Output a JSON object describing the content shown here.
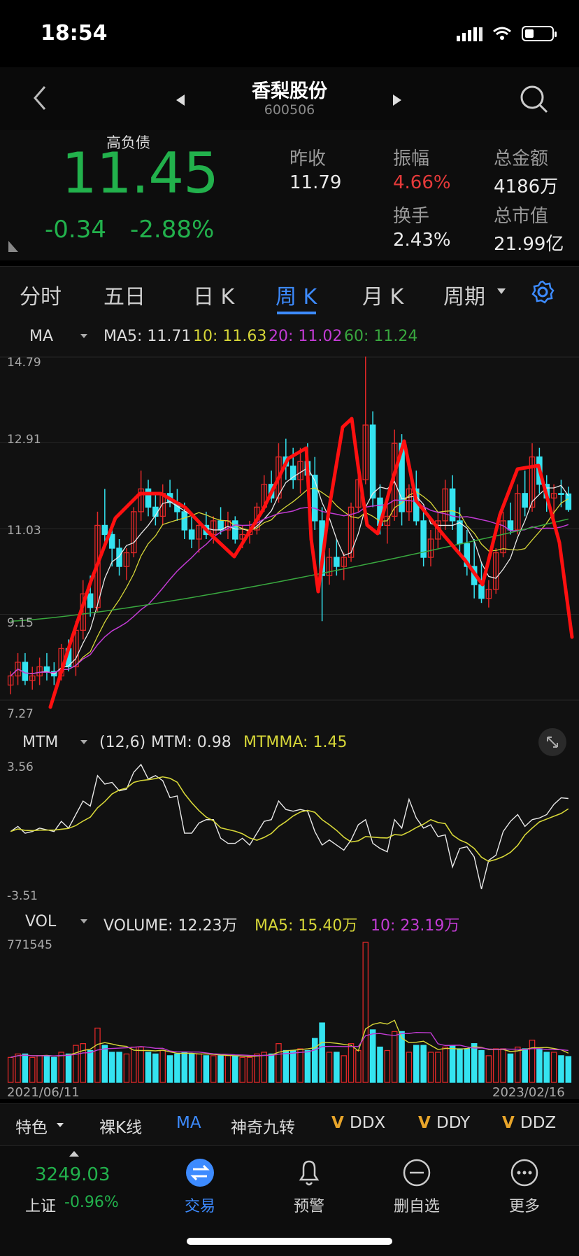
{
  "status": {
    "time": "18:54"
  },
  "header": {
    "title": "香梨股份",
    "code": "600506"
  },
  "quote": {
    "tag": "高负债",
    "price": "11.45",
    "change": "-0.34",
    "change_pct": "-2.88%",
    "stats": [
      {
        "label": "昨收",
        "value": "11.79",
        "color": "#eaeaea"
      },
      {
        "label": "振幅",
        "value": "4.66%",
        "color": "#e63a3a"
      },
      {
        "label": "总金额",
        "value": "4186万",
        "color": "#eaeaea"
      },
      {
        "label": "换手",
        "value": "2.43%",
        "color": "#eaeaea"
      },
      {
        "label": "总市值",
        "value": "21.99亿",
        "color": "#eaeaea"
      }
    ]
  },
  "tabs": [
    "分时",
    "五日",
    "日 K",
    "周 K",
    "月 K",
    "周期"
  ],
  "active_tab": "周 K",
  "ma_legend": {
    "name": "MA",
    "ma5": "MA5: 11.71",
    "ma10": "10: 11.63",
    "ma20": "20: 11.02",
    "ma60": "60: 11.24"
  },
  "mtm_legend": {
    "name": "MTM",
    "params": "(12,6)",
    "mtm": "MTM: 0.98",
    "mtmma": "MTMMA: 1.45"
  },
  "vol_legend": {
    "name": "VOL",
    "volume": "VOLUME: 12.23万",
    "ma5": "MA5: 15.40万",
    "ma10": "10: 23.19万"
  },
  "chart_data": {
    "type": "candlestick",
    "price_axis_labels": [
      "14.79",
      "12.91",
      "11.03",
      "9.15",
      "7.27"
    ],
    "mtm_axis_labels": [
      "3.56",
      "-3.51"
    ],
    "vol_axis_label": "771545",
    "date_start": "2021/06/11",
    "date_end": "2023/02/16",
    "colors": {
      "up": "#e02828",
      "down": "#34e3f0",
      "ma5": "#e8e8e8",
      "ma10": "#d6d638",
      "ma20": "#c23bd4",
      "ma60": "#39a83f",
      "annotation": "#ff1010"
    },
    "ohlc": [
      [
        7.6,
        7.9,
        7.4,
        7.8
      ],
      [
        7.8,
        8.3,
        7.6,
        8.1
      ],
      [
        8.1,
        8.3,
        7.6,
        7.7
      ],
      [
        7.7,
        8.0,
        7.5,
        7.8
      ],
      [
        7.8,
        8.2,
        7.6,
        8.0
      ],
      [
        8.0,
        8.3,
        7.7,
        7.9
      ],
      [
        7.9,
        8.1,
        7.6,
        7.8
      ],
      [
        7.8,
        8.5,
        7.7,
        8.4
      ],
      [
        8.4,
        8.6,
        7.9,
        8.0
      ],
      [
        8.0,
        9.0,
        7.8,
        8.8
      ],
      [
        8.8,
        9.9,
        8.6,
        9.6
      ],
      [
        9.6,
        10.0,
        9.1,
        9.3
      ],
      [
        9.3,
        11.4,
        9.2,
        11.1
      ],
      [
        11.1,
        11.9,
        10.7,
        10.9
      ],
      [
        10.9,
        11.0,
        10.2,
        10.6
      ],
      [
        10.6,
        10.8,
        10.0,
        10.2
      ],
      [
        10.2,
        10.6,
        9.9,
        10.5
      ],
      [
        10.5,
        11.5,
        10.4,
        11.4
      ],
      [
        11.4,
        12.3,
        11.2,
        11.9
      ],
      [
        11.9,
        12.1,
        11.3,
        11.5
      ],
      [
        11.5,
        11.8,
        11.1,
        11.3
      ],
      [
        11.3,
        12.0,
        11.1,
        11.8
      ],
      [
        11.8,
        12.1,
        11.5,
        11.6
      ],
      [
        11.6,
        11.9,
        11.2,
        11.4
      ],
      [
        11.4,
        11.6,
        10.8,
        11.0
      ],
      [
        11.0,
        11.3,
        10.6,
        10.8
      ],
      [
        10.8,
        11.2,
        10.5,
        11.1
      ],
      [
        11.1,
        11.4,
        10.8,
        10.9
      ],
      [
        10.9,
        11.3,
        10.7,
        11.2
      ],
      [
        11.2,
        11.5,
        10.9,
        11.0
      ],
      [
        11.0,
        11.4,
        10.8,
        11.2
      ],
      [
        11.2,
        11.3,
        10.7,
        10.8
      ],
      [
        10.8,
        11.1,
        10.6,
        10.9
      ],
      [
        10.9,
        11.2,
        10.7,
        11.0
      ],
      [
        11.0,
        11.6,
        10.9,
        11.5
      ],
      [
        11.5,
        12.2,
        11.4,
        12.0
      ],
      [
        12.0,
        12.3,
        11.6,
        11.7
      ],
      [
        11.7,
        12.9,
        11.6,
        12.6
      ],
      [
        12.6,
        13.0,
        12.1,
        12.4
      ],
      [
        12.4,
        12.8,
        11.9,
        12.1
      ],
      [
        12.1,
        12.8,
        11.8,
        12.5
      ],
      [
        12.5,
        12.9,
        12.0,
        12.2
      ],
      [
        12.2,
        12.6,
        11.0,
        11.2
      ],
      [
        11.2,
        11.5,
        9.0,
        10.0
      ],
      [
        10.0,
        10.6,
        9.8,
        10.4
      ],
      [
        10.4,
        10.8,
        10.0,
        10.2
      ],
      [
        10.2,
        10.5,
        9.9,
        10.4
      ],
      [
        10.4,
        11.6,
        10.3,
        11.5
      ],
      [
        11.5,
        12.3,
        11.4,
        12.1
      ],
      [
        12.1,
        14.8,
        12.0,
        13.3
      ],
      [
        13.3,
        13.6,
        11.5,
        11.7
      ],
      [
        11.7,
        12.0,
        10.9,
        11.1
      ],
      [
        11.1,
        11.6,
        10.7,
        11.3
      ],
      [
        11.3,
        13.2,
        11.2,
        12.9
      ],
      [
        12.9,
        13.1,
        11.1,
        11.4
      ],
      [
        11.4,
        12.0,
        11.2,
        11.9
      ],
      [
        11.9,
        12.3,
        11.1,
        11.2
      ],
      [
        11.2,
        11.4,
        10.2,
        10.4
      ],
      [
        10.4,
        11.0,
        10.2,
        10.8
      ],
      [
        10.8,
        11.4,
        10.6,
        11.2
      ],
      [
        11.2,
        12.1,
        11.0,
        11.9
      ],
      [
        11.9,
        12.2,
        11.0,
        11.2
      ],
      [
        11.2,
        11.5,
        10.5,
        10.7
      ],
      [
        10.7,
        11.0,
        10.0,
        10.2
      ],
      [
        10.2,
        10.8,
        9.5,
        9.8
      ],
      [
        9.8,
        10.3,
        9.4,
        9.5
      ],
      [
        9.5,
        9.9,
        9.3,
        9.7
      ],
      [
        9.7,
        10.6,
        9.6,
        10.5
      ],
      [
        10.5,
        11.4,
        10.4,
        11.2
      ],
      [
        11.2,
        11.6,
        10.9,
        11.0
      ],
      [
        11.0,
        12.0,
        10.9,
        11.8
      ],
      [
        11.8,
        12.3,
        11.3,
        11.5
      ],
      [
        11.5,
        12.9,
        11.4,
        12.6
      ],
      [
        12.6,
        12.8,
        11.8,
        12.0
      ],
      [
        12.0,
        12.2,
        11.4,
        11.7
      ],
      [
        11.7,
        12.0,
        11.2,
        11.8
      ],
      [
        11.8,
        12.1,
        11.5,
        11.79
      ],
      [
        11.79,
        11.95,
        11.4,
        11.45
      ]
    ]
  },
  "toolbar": {
    "special": "特色",
    "items": [
      "裸K线",
      "MA",
      "神奇九转",
      "DDX",
      "DDY",
      "DDZ"
    ],
    "v": "V"
  },
  "index": {
    "value": "3249.03",
    "name": "上证",
    "change": "-0.96%"
  },
  "bottom_nav": [
    "交易",
    "预警",
    "删自选",
    "更多"
  ]
}
